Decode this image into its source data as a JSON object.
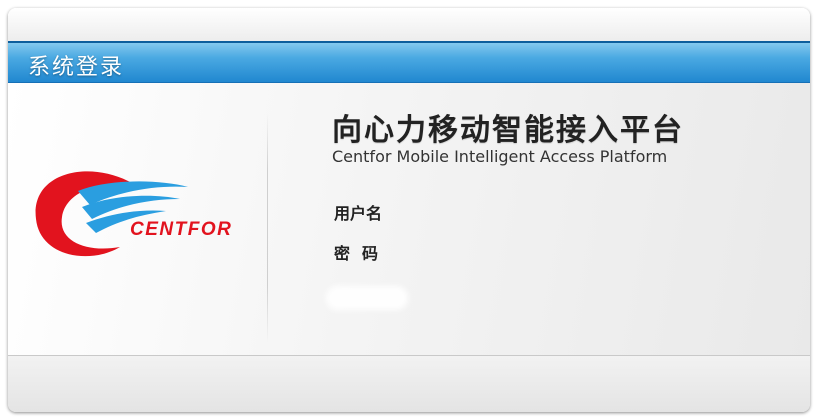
{
  "window": {
    "title": "系统登录"
  },
  "brand": {
    "logo_text": "CENTFOR",
    "colors": {
      "red": "#e2131e",
      "blue": "#2a9ee0",
      "titlebar": "#1f86cf"
    }
  },
  "platform": {
    "name_cn": "向心力移动智能接入平台",
    "name_en": "Centfor Mobile Intelligent Access Platform"
  },
  "form": {
    "username_label": "用户名",
    "password_label": "密码"
  }
}
